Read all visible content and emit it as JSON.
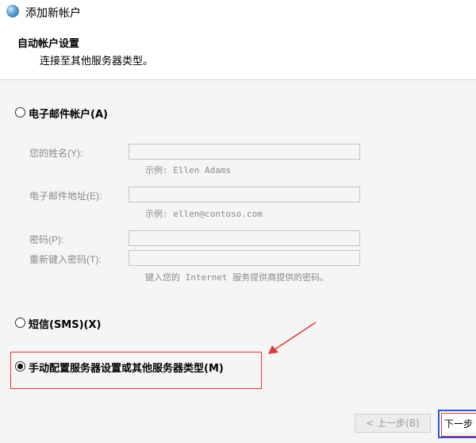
{
  "window": {
    "title": "添加新帐户"
  },
  "header": {
    "title": "自动帐户设置",
    "subtitle": "连接至其他服务器类型。"
  },
  "options": {
    "email_account": {
      "label": "电子邮件帐户(A)",
      "selected": false
    },
    "sms": {
      "label": "短信(SMS)(X)",
      "selected": false
    },
    "manual": {
      "label": "手动配置服务器设置或其他服务器类型(M)",
      "selected": true
    }
  },
  "form": {
    "name_label": "您的姓名(Y):",
    "name_hint": "示例: Ellen Adams",
    "email_label": "电子邮件地址(E):",
    "email_hint": "示例: ellen@contoso.com",
    "password_label": "密码(P):",
    "retype_label": "重新键入密码(T):",
    "password_hint": "键入您的 Internet 服务提供商提供的密码。"
  },
  "buttons": {
    "back": "< 上一步(B)",
    "next": "下一步"
  },
  "colors": {
    "annotation_red": "#d83a3a",
    "focus_blue": "#2a53d7"
  }
}
